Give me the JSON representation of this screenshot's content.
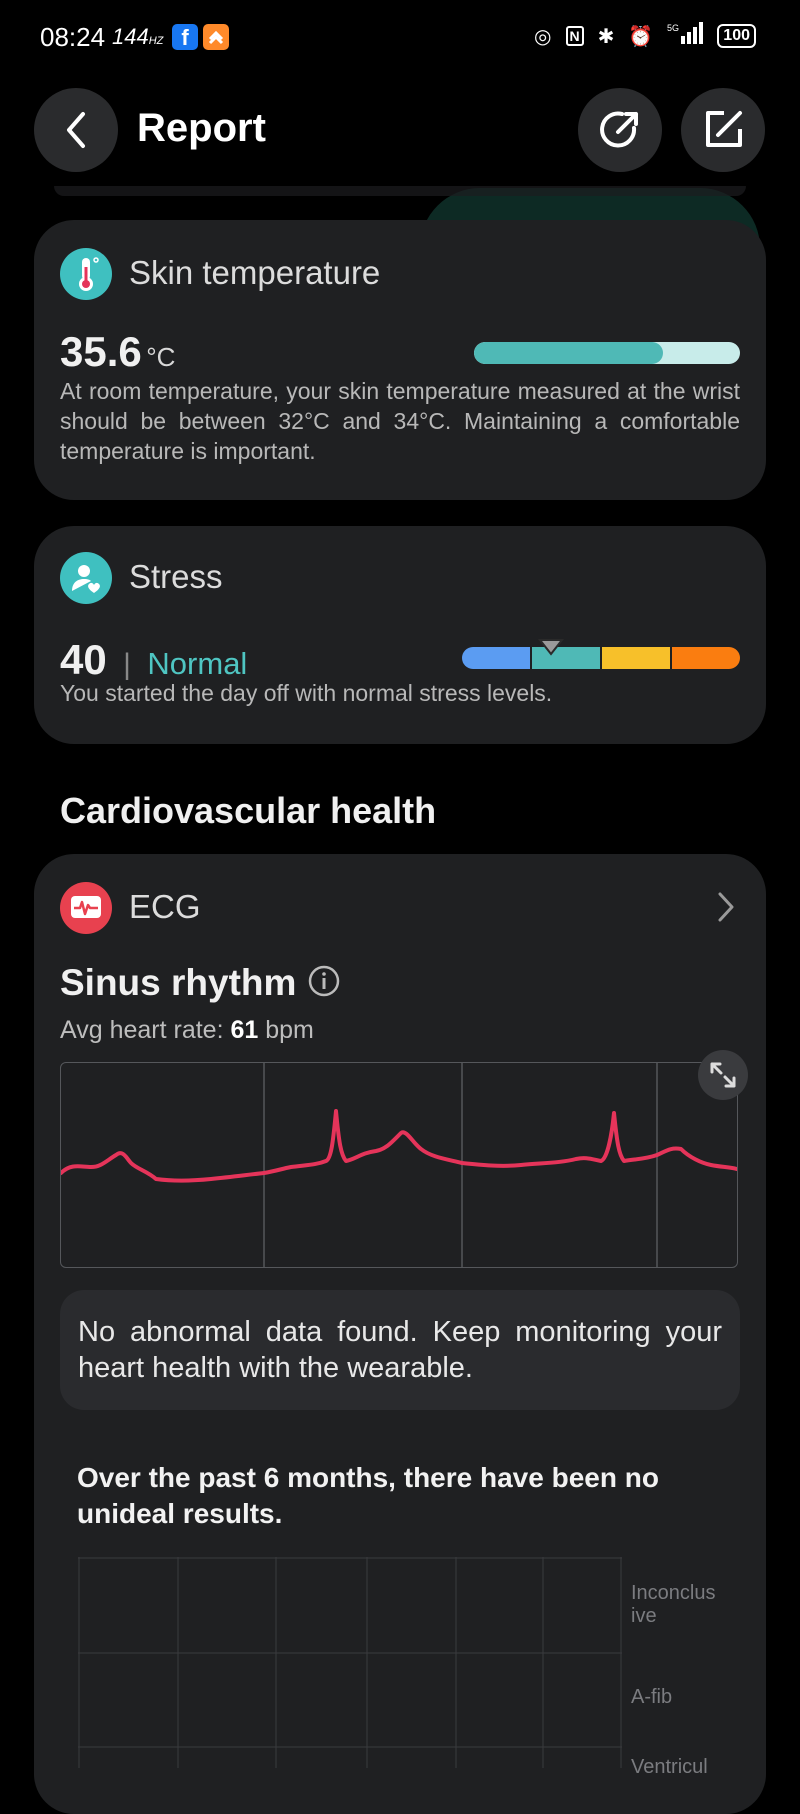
{
  "status_bar": {
    "time": "08:24",
    "refresh": "144",
    "battery": "100"
  },
  "header": {
    "title": "Report"
  },
  "skin_temperature": {
    "title": "Skin temperature",
    "value": "35.6",
    "unit": "°C",
    "bar_fill_fraction": 0.71,
    "description": "At room temperature, your skin temperature measured at the wrist should be between 32°C and 34°C. Maintaining a comfortable temperature is important."
  },
  "stress": {
    "title": "Stress",
    "value": "40",
    "separator": "|",
    "level": "Normal",
    "description": "You started the day off with normal stress levels.",
    "colors": [
      "#5b9cf2",
      "#4fb9b6",
      "#f7c02a",
      "#fa7d10"
    ],
    "marker_fraction": 0.32
  },
  "section": {
    "title": "Cardiovascular health"
  },
  "ecg": {
    "title": "ECG",
    "result": "Sinus rhythm",
    "avg_label": "Avg heart rate:",
    "avg_value": "61",
    "avg_unit": "bpm",
    "note": "No abnormal data found. Keep monitoring your heart health with the wearable.",
    "past_summary": "Over the past 6 months, there have been no unideal results.",
    "history_labels": [
      "Inconclus ive",
      "A-fib",
      "Ventricul"
    ]
  },
  "colors": {
    "teal": "#3fc0c0",
    "ecg_line": "#e5345a",
    "card": "#1f2022"
  }
}
